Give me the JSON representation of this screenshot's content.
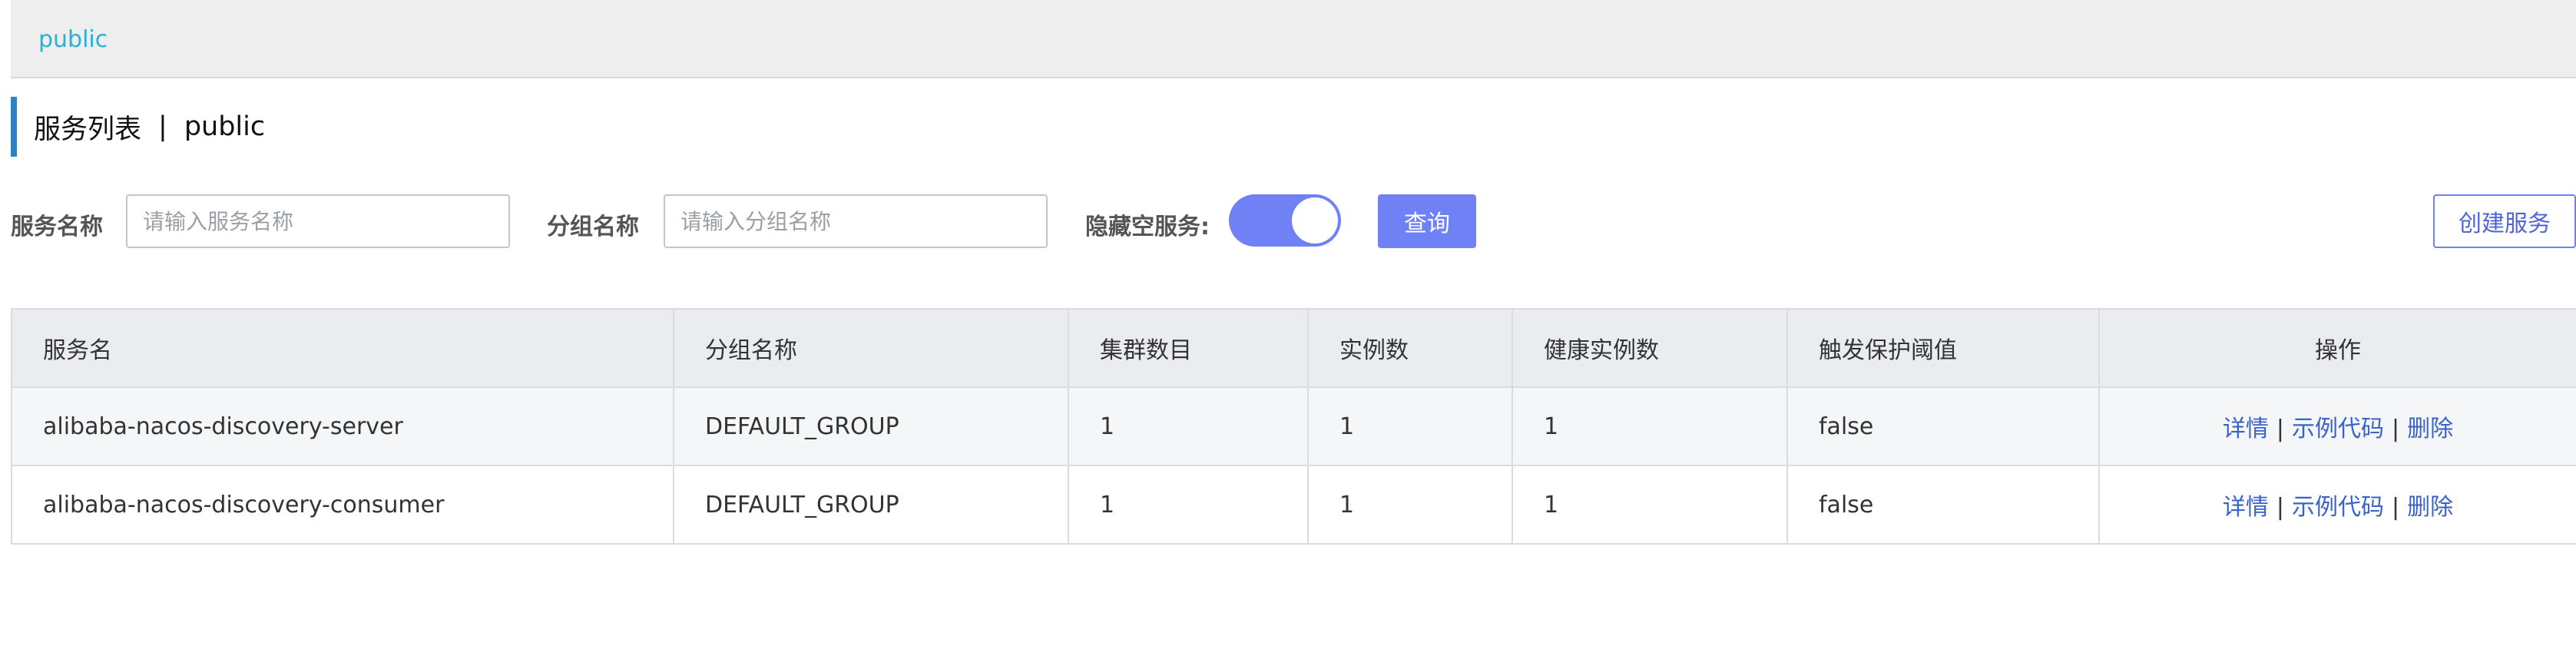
{
  "namespace_bar": {
    "active_namespace": "public"
  },
  "page_title": {
    "title": "服务列表",
    "separator": "|",
    "namespace": "public"
  },
  "filters": {
    "service_name_label": "服务名称",
    "service_name_placeholder": "请输入服务名称",
    "service_name_value": "",
    "group_name_label": "分组名称",
    "group_name_placeholder": "请输入分组名称",
    "group_name_value": "",
    "hide_empty_label": "隐藏空服务:",
    "hide_empty_enabled": true,
    "query_button": "查询",
    "create_button": "创建服务"
  },
  "colors": {
    "accent": "#6f81f5",
    "namespace_link": "#2ab1d4",
    "title_bar": "#2a84c7",
    "link": "#3a63c9"
  },
  "table": {
    "headers": [
      "服务名",
      "分组名称",
      "集群数目",
      "实例数",
      "健康实例数",
      "触发保护阈值",
      "操作"
    ],
    "rows": [
      {
        "service_name": "alibaba-nacos-discovery-server",
        "group_name": "DEFAULT_GROUP",
        "cluster_count": "1",
        "instance_count": "1",
        "healthy_instance_count": "1",
        "protect_threshold": "false",
        "actions": {
          "detail": "详情",
          "sample_code": "示例代码",
          "delete": "删除",
          "separator": "|"
        }
      },
      {
        "service_name": "alibaba-nacos-discovery-consumer",
        "group_name": "DEFAULT_GROUP",
        "cluster_count": "1",
        "instance_count": "1",
        "healthy_instance_count": "1",
        "protect_threshold": "false",
        "actions": {
          "detail": "详情",
          "sample_code": "示例代码",
          "delete": "删除",
          "separator": "|"
        }
      }
    ]
  }
}
